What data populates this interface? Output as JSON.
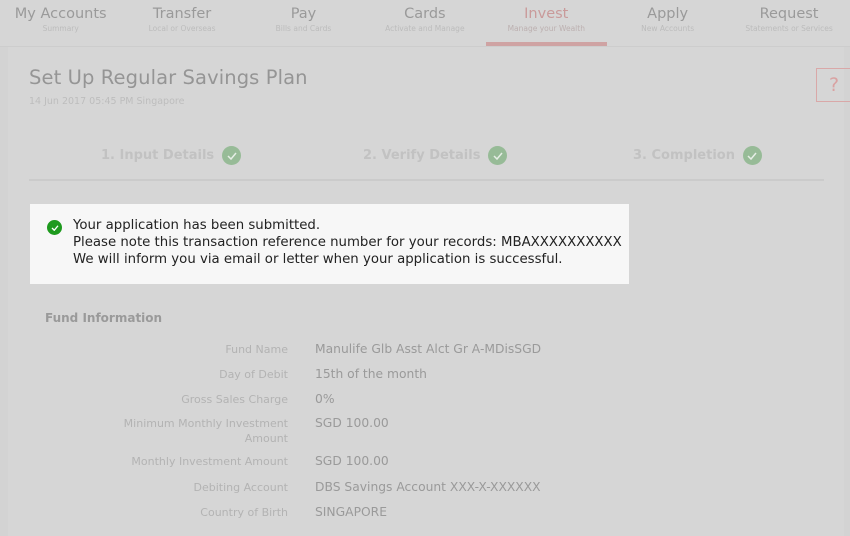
{
  "nav": {
    "items": [
      {
        "label": "My Accounts",
        "sub": "Summary"
      },
      {
        "label": "Transfer",
        "sub": "Local or Overseas"
      },
      {
        "label": "Pay",
        "sub": "Bills and Cards"
      },
      {
        "label": "Cards",
        "sub": "Activate and Manage"
      },
      {
        "label": "Invest",
        "sub": "Manage your Wealth"
      },
      {
        "label": "Apply",
        "sub": "New Accounts"
      },
      {
        "label": "Request",
        "sub": "Statements or Services"
      }
    ],
    "active_index": 4
  },
  "header": {
    "title": "Set Up Regular Savings Plan",
    "datetime": "14 Jun 2017 05:45 PM Singapore",
    "help_label": "?"
  },
  "steps": [
    {
      "label": "1. Input Details",
      "status": "complete"
    },
    {
      "label": "2. Verify Details",
      "status": "complete"
    },
    {
      "label": "3. Completion",
      "status": "complete"
    }
  ],
  "notice": {
    "line1": "Your application has been submitted.",
    "line2": "Please note this transaction reference number for your records: MBAXXXXXXXXXX",
    "line3": "We will inform you via email or letter when your application is successful.",
    "icon": "check-circle-icon",
    "color": "#1e9a1e"
  },
  "fund_info": {
    "title": "Fund Information",
    "rows": [
      {
        "label": "Fund Name",
        "value": "Manulife Glb Asst Alct Gr A-MDisSGD"
      },
      {
        "label": "Day of Debit",
        "value": "15th of the month"
      },
      {
        "label": "Gross Sales Charge",
        "value": "0%"
      },
      {
        "label": "Minimum Monthly Investment Amount",
        "value": "SGD 100.00"
      },
      {
        "label": "Monthly Investment Amount",
        "value": "SGD 100.00"
      },
      {
        "label": "Debiting Account",
        "value": "DBS Savings Account XXX-X-XXXXXX"
      },
      {
        "label": "Country of Birth",
        "value": "SINGAPORE"
      }
    ]
  },
  "colors": {
    "accent": "#cfa3a3",
    "success": "#1e9a1e",
    "overlay": "#d6d6d6"
  }
}
